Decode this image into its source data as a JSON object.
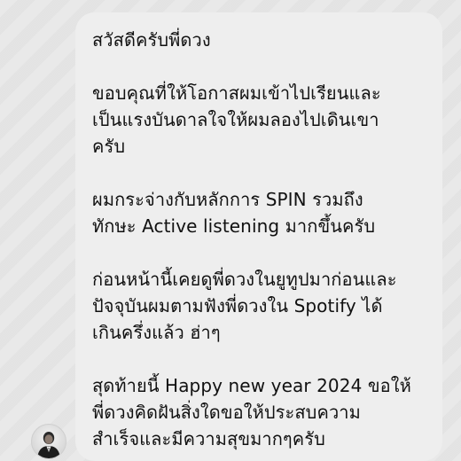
{
  "message": {
    "greeting": "สวัสดีครับพี่ดวง",
    "paragraph_1": "ขอบคุณที่ให้โอกาสผมเข้าไปเรียนและ\nเป็นแรงบันดาลใจให้ผมลองไปเดินเขา\nครับ",
    "paragraph_2": "ผมกระจ่างกับหลักการ SPIN รวมถึง\nทักษะ Active listening มากขึ้นครับ",
    "paragraph_3": "ก่อนหน้านี้เคยดูพี่ดวงในยูทูปมาก่อนและ\nปัจจุบันผมตามฟังพี่ดวงใน Spotify ได้\nเกินครึ่งแล้ว ฮ่าๆ",
    "paragraph_4": "สุดท้ายนี้ Happy new year 2024 ขอให้\nพี่ดวงคิดฝันสิ่งใดขอให้ประสบความ\nสำเร็จและมีความสุขมากๆครับ"
  },
  "colors": {
    "bubble_background": "#eeeeee",
    "text": "#111111",
    "page_background": "#e7e7e7"
  },
  "icons": {
    "avatar": "sender-avatar-icon"
  }
}
